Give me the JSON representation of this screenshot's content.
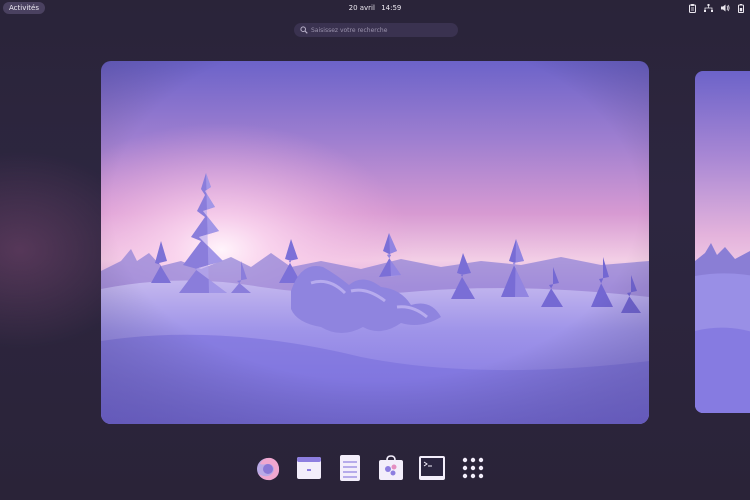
{
  "topbar": {
    "activities_label": "Activités",
    "date": "20 avril",
    "time": "14:59",
    "tray_icons": [
      "clipboard-icon",
      "network-icon",
      "volume-icon",
      "battery-icon"
    ]
  },
  "search": {
    "placeholder": "Saisissez votre recherche"
  },
  "workspaces": {
    "main_wallpaper": "snowy-forest-sunset",
    "next_wallpaper": "snowy-forest-sunset"
  },
  "dash": {
    "items": [
      "firefox-icon",
      "files-icon",
      "text-editor-icon",
      "software-icon",
      "terminal-icon",
      "app-grid-icon"
    ]
  },
  "colors": {
    "background": "#2a2439",
    "activities_pill": "#4a4160",
    "search_field": "#3a3250",
    "sky_top": "#6d63c8",
    "sky_glow": "#e8a7d7",
    "snow": "#8f86e6"
  }
}
